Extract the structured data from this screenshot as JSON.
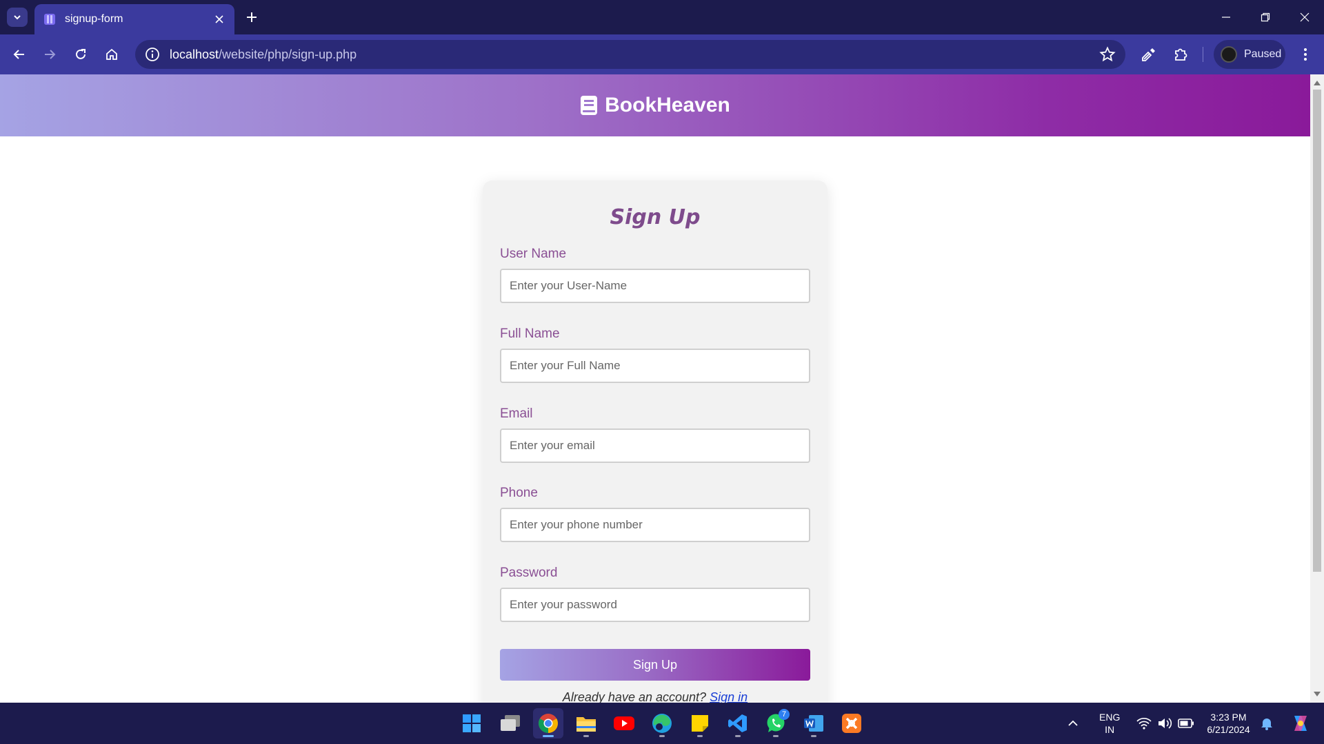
{
  "browser": {
    "tab_title": "signup-form",
    "url_host": "localhost",
    "url_path": "/website/php/sign-up.php",
    "profile_label": "Paused"
  },
  "site": {
    "brand": "BookHeaven"
  },
  "form": {
    "title": "Sign Up",
    "fields": [
      {
        "label": "User Name",
        "placeholder": "Enter your User-Name"
      },
      {
        "label": "Full Name",
        "placeholder": "Enter your Full Name"
      },
      {
        "label": "Email",
        "placeholder": "Enter your email"
      },
      {
        "label": "Phone",
        "placeholder": "Enter your phone number"
      },
      {
        "label": "Password",
        "placeholder": "Enter your password"
      }
    ],
    "submit_label": "Sign Up",
    "signin_prompt": "Already have an account?",
    "signin_link": "Sign in"
  },
  "taskbar": {
    "apps": [
      "start-icon",
      "task-view-icon",
      "chrome-icon",
      "file-explorer-icon",
      "youtube-icon",
      "edge-icon",
      "sticky-notes-icon",
      "vscode-icon",
      "whatsapp-icon",
      "word-icon",
      "xampp-icon"
    ],
    "whatsapp_badge": "7",
    "language_top": "ENG",
    "language_bottom": "IN",
    "time": "3:23 PM",
    "date": "6/21/2024"
  },
  "colors": {
    "chrome_dark": "#1c1b4d",
    "chrome_toolbar": "#3b3a9e",
    "accent_purple": "#8a1a9a",
    "label_purple": "#8a4f94",
    "link_blue": "#1a3fd6"
  }
}
